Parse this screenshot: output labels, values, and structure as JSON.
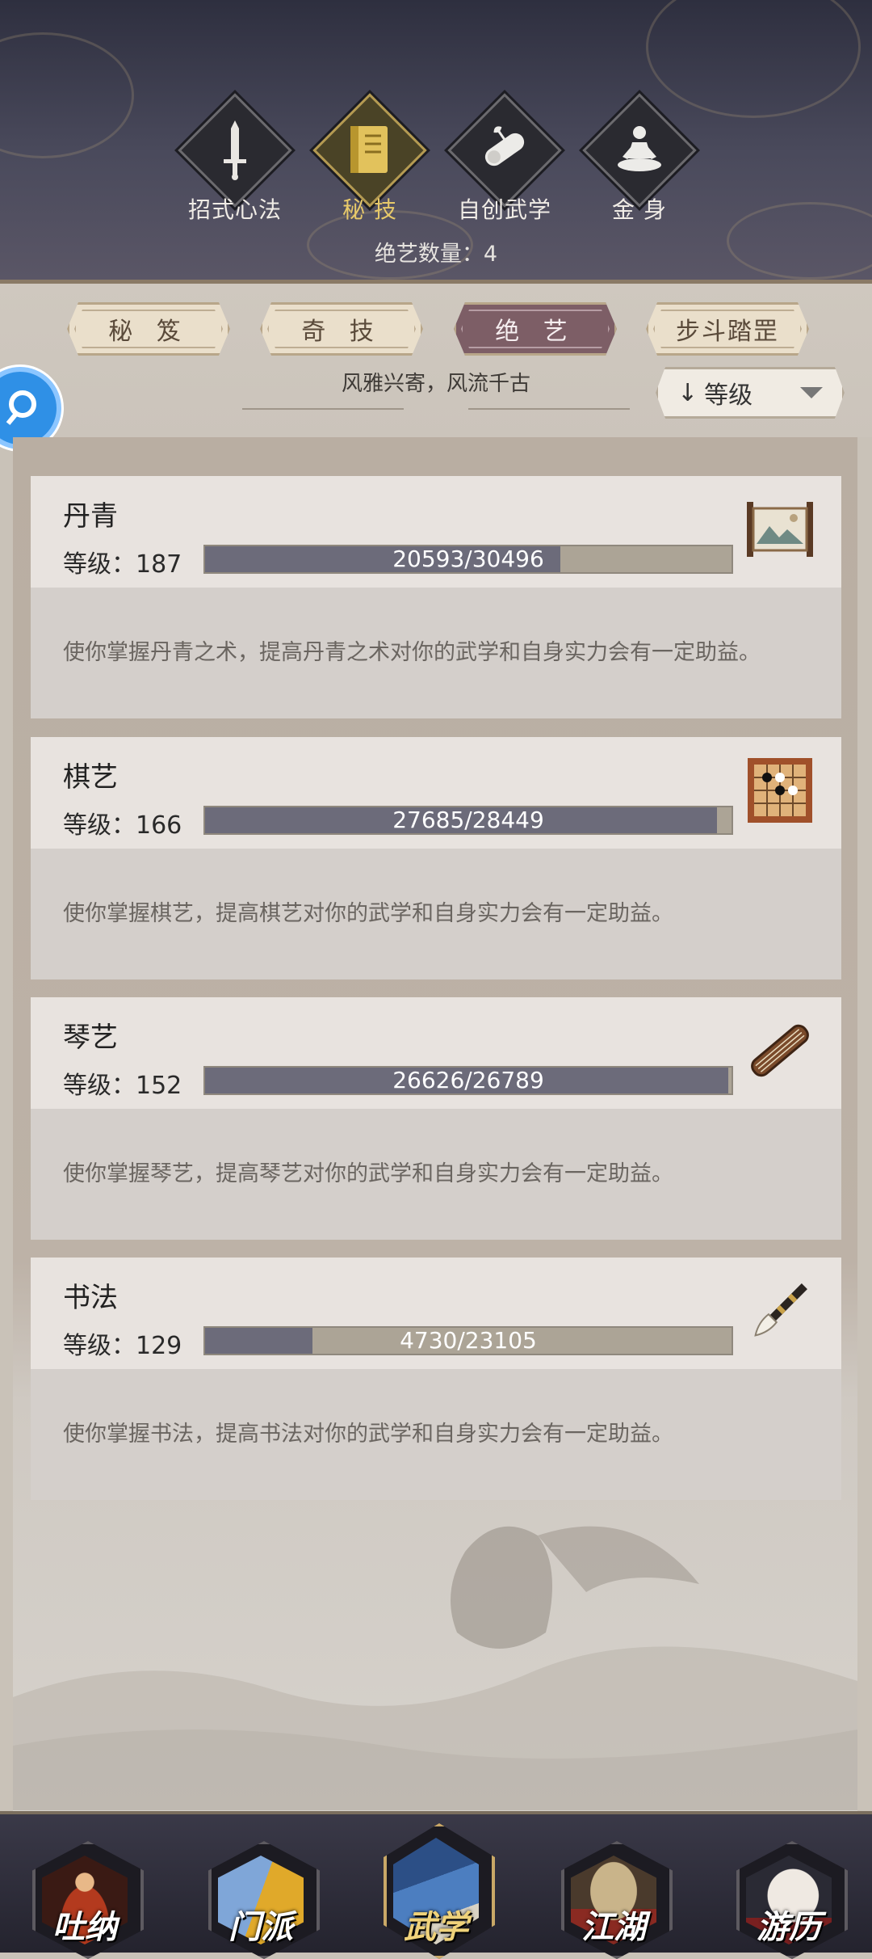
{
  "header": {
    "tabs": [
      {
        "label": "招式心法",
        "icon": "sword-icon",
        "active": false
      },
      {
        "label": "秘 技",
        "icon": "scroll-book-icon",
        "active": true
      },
      {
        "label": "自创武学",
        "icon": "scroll-roll-icon",
        "active": false
      },
      {
        "label": "金 身",
        "icon": "meditation-icon",
        "active": false
      }
    ],
    "count_text": "绝艺数量：4"
  },
  "sub_tabs": [
    {
      "label": "秘 笈",
      "active": false
    },
    {
      "label": "奇 技",
      "active": false
    },
    {
      "label": "绝 艺",
      "active": true
    },
    {
      "label": "步斗踏罡",
      "active": false
    }
  ],
  "motto": "风雅兴寄，风流千古",
  "sort": {
    "arrow": "↓",
    "label": "等级"
  },
  "skills": [
    {
      "name": "丹青",
      "level_text": "等级：187",
      "current": 20593,
      "max": 30496,
      "progress_text": "20593/30496",
      "description": "使你掌握丹青之术，提高丹青之术对你的武学和自身实力会有一定助益。",
      "icon": "painting-scroll-icon"
    },
    {
      "name": "棋艺",
      "level_text": "等级：166",
      "current": 27685,
      "max": 28449,
      "progress_text": "27685/28449",
      "description": "使你掌握棋艺，提高棋艺对你的武学和自身实力会有一定助益。",
      "icon": "go-board-icon"
    },
    {
      "name": "琴艺",
      "level_text": "等级：152",
      "current": 26626,
      "max": 26789,
      "progress_text": "26626/26789",
      "description": "使你掌握琴艺，提高琴艺对你的武学和自身实力会有一定助益。",
      "icon": "guqin-icon"
    },
    {
      "name": "书法",
      "level_text": "等级：129",
      "current": 4730,
      "max": 23105,
      "progress_text": "4730/23105",
      "description": "使你掌握书法，提高书法对你的武学和自身实力会有一定助益。",
      "icon": "brush-icon"
    }
  ],
  "bottom_nav": [
    {
      "label": "吐纳",
      "active": false,
      "icon": "monk-icon"
    },
    {
      "label": "门派",
      "active": false,
      "icon": "sect-banner-icon"
    },
    {
      "label": "武学",
      "active": true,
      "icon": "martial-books-icon"
    },
    {
      "label": "江湖",
      "active": false,
      "icon": "straw-hat-icon"
    },
    {
      "label": "游历",
      "active": false,
      "icon": "horse-icon"
    }
  ],
  "colors": {
    "accent_gold": "#e7c96a",
    "active_subtab": "#7d5e66",
    "progress_fill": "#6c6b7a",
    "search_fab": "#2f90e6"
  }
}
